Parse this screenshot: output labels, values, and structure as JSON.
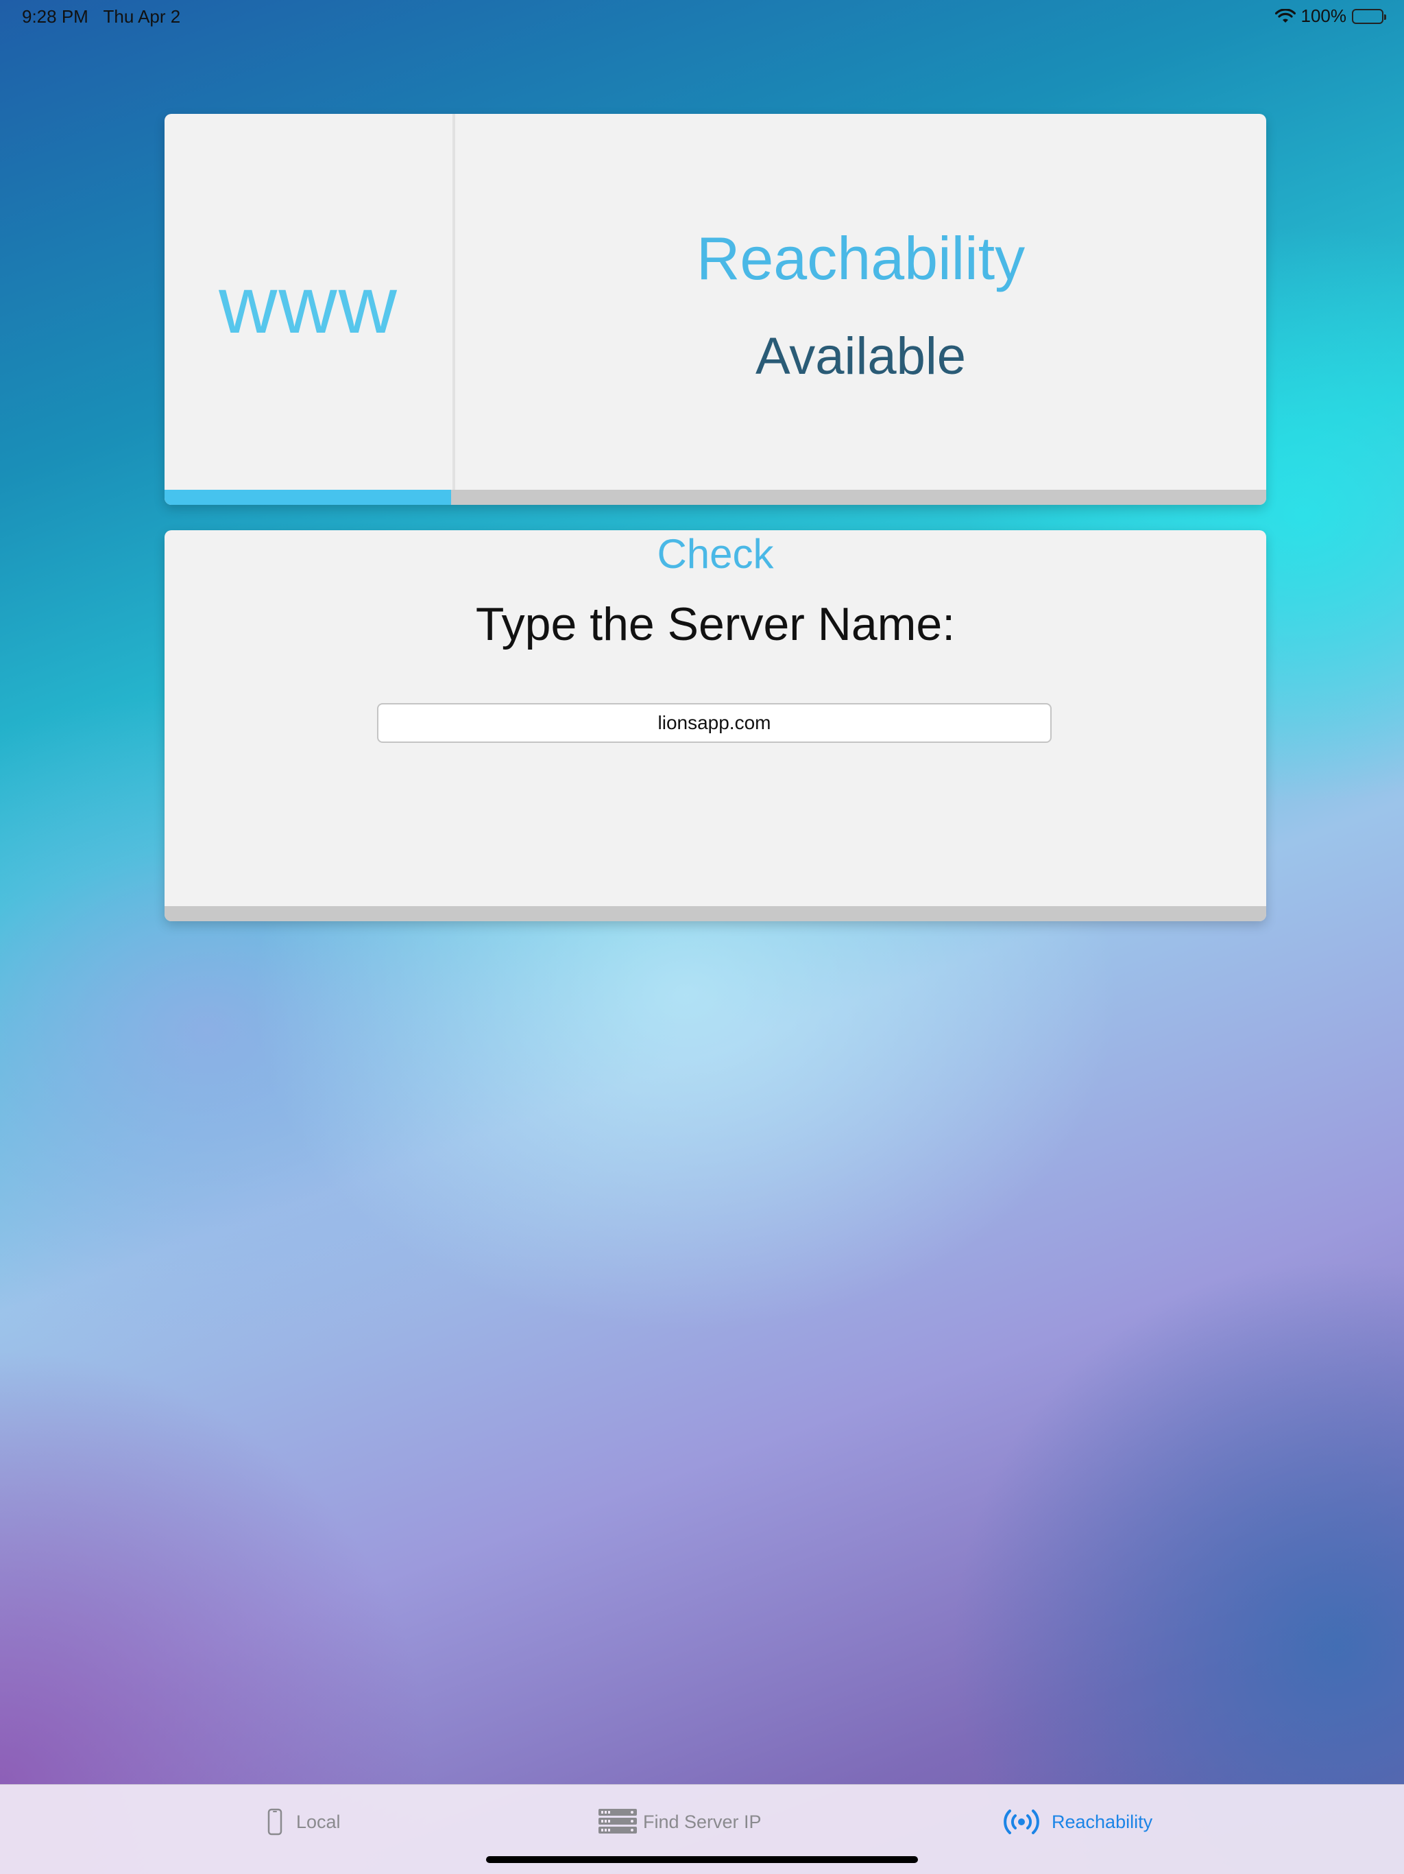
{
  "status_bar": {
    "time": "9:28 PM",
    "date": "Thu Apr 2",
    "battery": "100%",
    "icons": [
      "wifi-icon",
      "battery-icon"
    ]
  },
  "reachability_card": {
    "logo_text": "www",
    "title": "Reachability",
    "status": "Available",
    "progress_fraction": 0.26,
    "colors": {
      "accent": "#46c3ee",
      "status_text": "#2a5b76"
    }
  },
  "server_card": {
    "prompt": "Type the Server Name:",
    "server_input": {
      "value": "lionsapp.com",
      "placeholder": ""
    },
    "check_label": "Check"
  },
  "tab_bar": {
    "tabs": [
      {
        "label": "Local",
        "icon": "phone-icon",
        "selected": false
      },
      {
        "label": "Find Server IP",
        "icon": "server-icon",
        "selected": false
      },
      {
        "label": "Reachability",
        "icon": "broadcast-icon",
        "selected": true
      }
    ],
    "selected_color": "#1b84e6"
  }
}
